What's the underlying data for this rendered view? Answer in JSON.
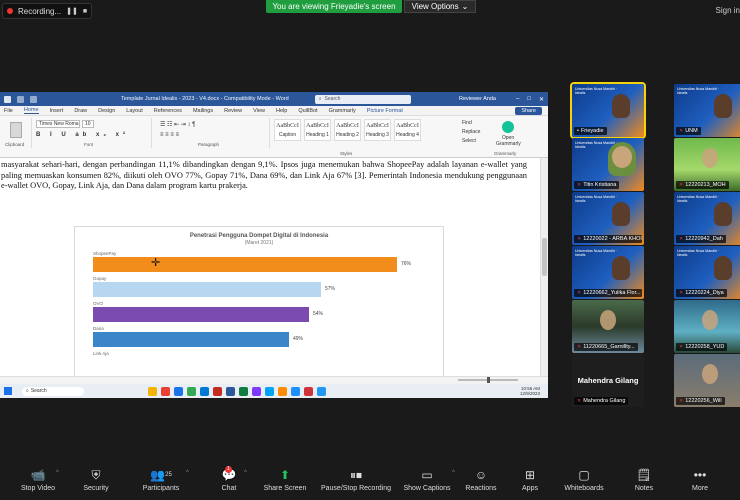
{
  "top": {
    "recording_label": "Recording...",
    "viewing_banner": "You are viewing Frieyadie's screen",
    "view_options": "View Options",
    "view_options_caret": "⌄",
    "sign_in": "Sign in"
  },
  "word": {
    "doc_title": "Template Jurnal Idealis - 2023 - V4.docx - Compatibility Mode - Word",
    "search_placeholder": "Search",
    "user": "Reviewer Anda",
    "menu": [
      "File",
      "Home",
      "Insert",
      "Draw",
      "Design",
      "Layout",
      "References",
      "Mailings",
      "Review",
      "View",
      "Help",
      "QuillBot",
      "Grammarly",
      "Picture Format"
    ],
    "share": "Share",
    "font_name": "Times New Roma",
    "font_size": "10",
    "format_buttons": "B I U ab x₂ x²",
    "group_labels": {
      "clipboard": "Clipboard",
      "font": "Font",
      "paragraph": "Paragraph",
      "styles": "Styles",
      "grammarly": "Grammarly"
    },
    "styles": [
      {
        "sample": "AaBbCcI",
        "name": "Caption"
      },
      {
        "sample": "AaBbCcI",
        "name": "Heading 1"
      },
      {
        "sample": "AaBbCcI",
        "name": "Heading 2"
      },
      {
        "sample": "AaBbCcI",
        "name": "Heading 3"
      },
      {
        "sample": "AaBbCcI",
        "name": "Heading 4"
      }
    ],
    "editing": [
      "Find",
      "Replace",
      "Select"
    ],
    "grammarly_btn": "Open Grammarly",
    "paragraph_text": "masyarakat sehari-hari, dengan perbandingan 11,1% dibandingkan dengan 9,1%. Ipsos juga menemukan bahwa ShopeePay adalah layanan e-wallet yang paling memuaskan konsumen 82%, diikuti oleh OVO 77%, Gopay 71%, Dana 69%, dan Link Aja 67% [3]. Pemerintah Indonesia mendukung penggunaan e-wallet OVO, Gopay, Link Aja, dan Dana dalam program kartu prakerja."
  },
  "chart_data": {
    "type": "bar",
    "title": "Penetrasi Pengguna Dompet Digital di Indonesia",
    "subtitle": "(Maret 2021)",
    "categories": [
      "ShopeePay",
      "Gopay",
      "OVO",
      "Dana",
      "Link Aja"
    ],
    "values": [
      76,
      57,
      54,
      49,
      null
    ],
    "value_labels": [
      "76%",
      "57%",
      "54%",
      "49%",
      ""
    ],
    "colors": [
      "#f28c1b",
      "#b7d7f0",
      "#7b4bb0",
      "#3a86c8",
      "#3a86c8"
    ],
    "xlim": [
      0,
      80
    ],
    "grid": false
  },
  "taskbar": {
    "search": "Search",
    "time": "10:56 AM",
    "date": "12/9/2023",
    "app_colors": [
      "#f4b400",
      "#e94235",
      "#1a73e8",
      "#34a853",
      "#0078d4",
      "#c42b1c",
      "#2b579a",
      "#107c41",
      "#7f39fb",
      "#00a4ef",
      "#ff8c00",
      "#1e90ff",
      "#d13438",
      "#2196f3"
    ]
  },
  "participants": [
    {
      "name": "Frieyadie",
      "active": true,
      "style": "banner",
      "mic_muted": false,
      "header": "Universitas Nusa Mandiri · Idealis"
    },
    {
      "name": "UNM",
      "style": "banner",
      "mic_muted": true,
      "header": "Universitas Nusa Mandiri · Idealis"
    },
    {
      "name": "Titin Kristiana",
      "style": "hijab",
      "mic_muted": true,
      "header": "Universitas Nusa Mandiri · Idealis"
    },
    {
      "name": "12220213_MOH",
      "style": "photo3",
      "mic_muted": true,
      "header": ""
    },
    {
      "name": "12220022 - ARBA KHOI...",
      "style": "banner",
      "mic_muted": true,
      "header": "Universitas Nusa Mandiri · Idealis"
    },
    {
      "name": "12220942_Dah",
      "style": "banner",
      "mic_muted": true,
      "header": "Universitas Nusa Mandiri · Idealis"
    },
    {
      "name": "12220662_Yulika Flor...",
      "style": "banner",
      "mic_muted": true,
      "header": "Universitas Nusa Mandiri · Idealis"
    },
    {
      "name": "12220224_Diya",
      "style": "banner",
      "mic_muted": true,
      "header": "Universitas Nusa Mandiri · Idealis"
    },
    {
      "name": "11220665_Garnillty...",
      "style": "photo1",
      "mic_muted": true,
      "header": ""
    },
    {
      "name": "12220258_YUD",
      "style": "photo2",
      "mic_muted": true,
      "header": ""
    },
    {
      "name": "Mahendra Gilang",
      "style": "plain",
      "mic_muted": true,
      "header": "",
      "display": "Mahendra Gilang"
    },
    {
      "name": "12220256_Will",
      "style": "photo4",
      "mic_muted": true,
      "header": ""
    }
  ],
  "toolbar": {
    "stop_video": "Stop Video",
    "security": "Security",
    "participants": "Participants",
    "participants_count": "25",
    "chat": "Chat",
    "chat_badge": "1",
    "share_screen": "Share Screen",
    "record": "Pause/Stop Recording",
    "captions": "Show Captions",
    "reactions": "Reactions",
    "apps": "Apps",
    "whiteboards": "Whiteboards",
    "notes": "Notes",
    "more": "More"
  }
}
